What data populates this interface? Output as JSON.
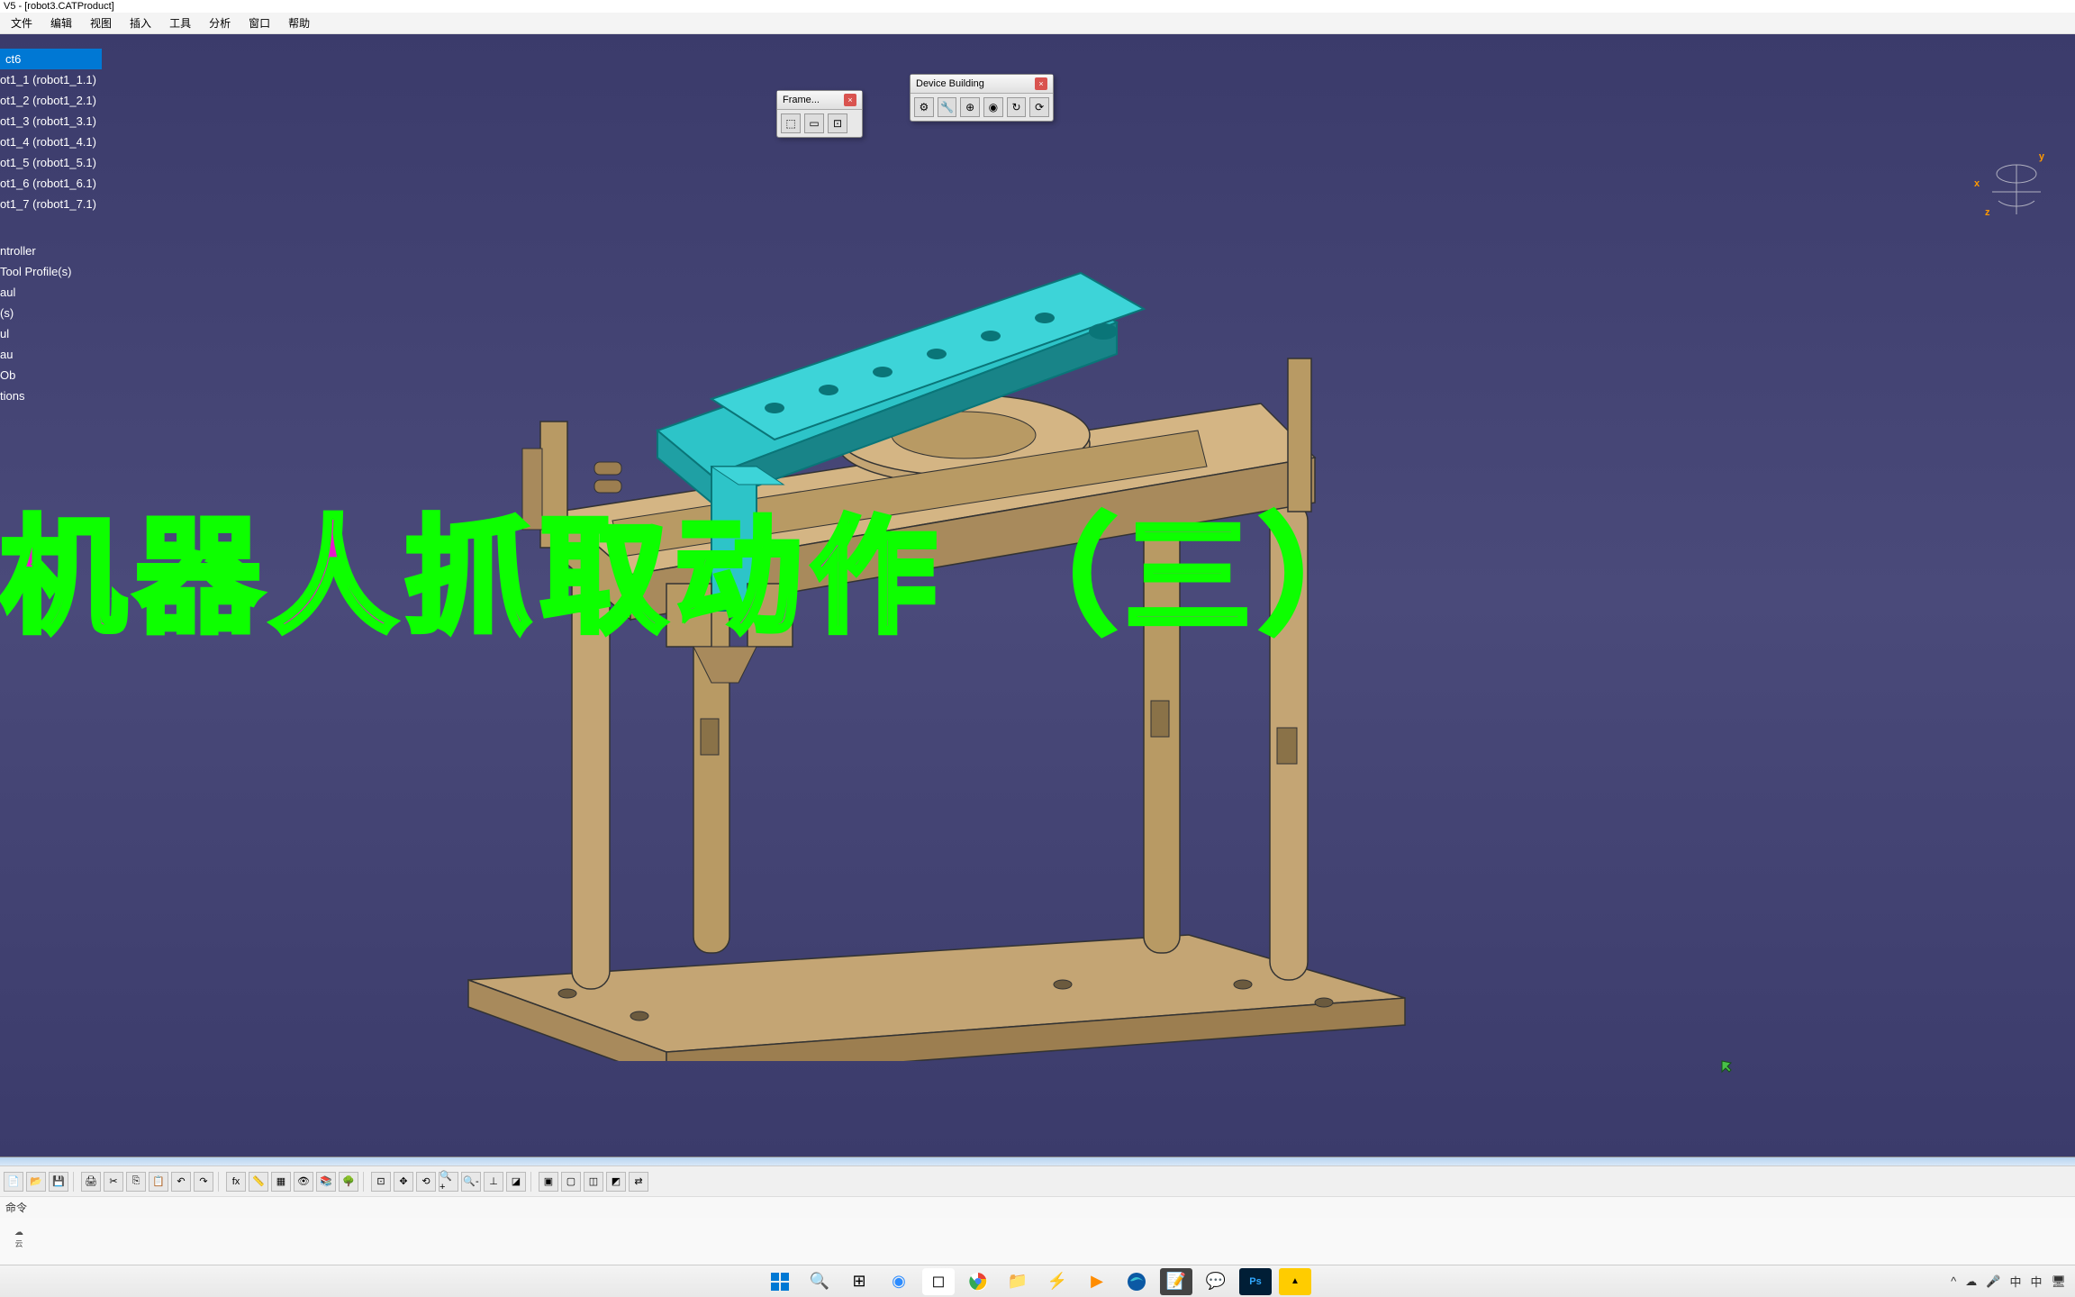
{
  "window": {
    "title": "V5 - [robot3.CATProduct]"
  },
  "menu": {
    "file": "文件",
    "edit": "编辑",
    "view": "视图",
    "insert": "插入",
    "tools": "工具",
    "analyze": "分析",
    "window": "窗口",
    "help": "帮助"
  },
  "tree": {
    "root": "ct6",
    "items": [
      "ot1_1 (robot1_1.1)",
      "ot1_2 (robot1_2.1)",
      "ot1_3 (robot1_3.1)",
      "ot1_4 (robot1_4.1)",
      "ot1_5 (robot1_5.1)",
      "ot1_6 (robot1_6.1)",
      "ot1_7 (robot1_7.1)"
    ],
    "extra": [
      "ntroller",
      "Tool Profile(s)",
      "aul",
      "(s)",
      "ul",
      "au",
      "Ob",
      "tions"
    ]
  },
  "toolbars": {
    "frame": {
      "title": "Frame..."
    },
    "device": {
      "title": "Device Building"
    }
  },
  "compass": {
    "x": "x",
    "y": "y",
    "z": "z"
  },
  "overlay": "机器人抓取动作  （三）",
  "command": {
    "prompt": "命令"
  },
  "systray": {
    "arrow": "^",
    "ime1": "中",
    "ime2": "中"
  }
}
